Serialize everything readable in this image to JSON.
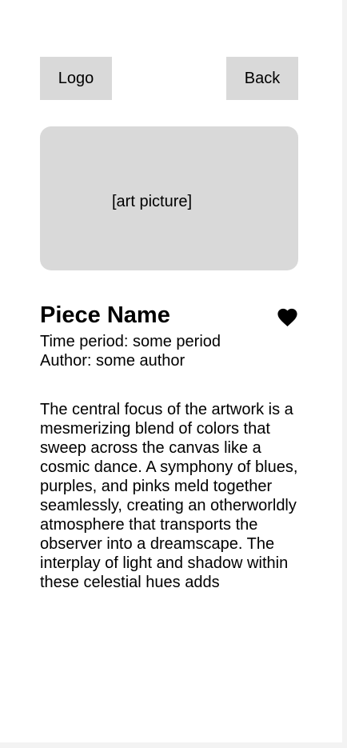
{
  "header": {
    "logo_label": "Logo",
    "back_label": "Back"
  },
  "artwork": {
    "image_placeholder": "[art picture]",
    "name": "Piece Name",
    "time_period": "Time period: some period",
    "author": "Author: some author",
    "favorite_icon": "heart-icon",
    "description": "The central focus of the artwork is a mesmerizing blend of colors that sweep across the canvas like a cosmic dance. A symphony of blues, purples, and pinks meld together seamlessly, creating an otherworldly atmosphere that transports the observer into a dreamscape. The interplay of light and shadow within these celestial hues adds"
  },
  "colors": {
    "placeholder_gray": "#d9d9d9",
    "text": "#000000",
    "background": "#ffffff"
  }
}
